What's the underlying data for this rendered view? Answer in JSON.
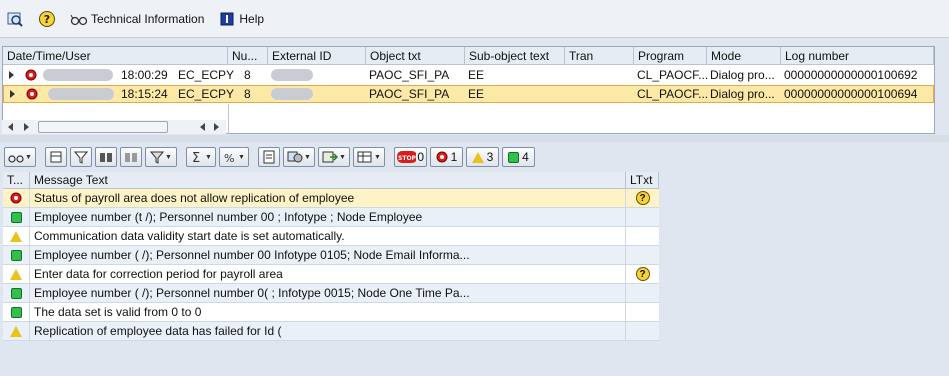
{
  "toolbar": {
    "tech_info_label": "Technical Information",
    "help_label": "Help"
  },
  "log_table": {
    "columns": [
      "Date/Time/User",
      "Nu...",
      "External ID",
      "Object txt",
      "Sub-object text",
      "Tran",
      "Program",
      "Mode",
      "Log number"
    ],
    "rows": [
      {
        "time": "18:00:29",
        "user": "EC_ECPY",
        "num": "8",
        "object": "PAOC_SFI_PA",
        "subobject": "EE",
        "program": "CL_PAOCF...",
        "mode": "Dialog pro...",
        "log": "00000000000000100692",
        "selected": false
      },
      {
        "time": "18:15:24",
        "user": "EC_ECPY",
        "num": "8",
        "object": "PAOC_SFI_PA",
        "subobject": "EE",
        "program": "CL_PAOCF...",
        "mode": "Dialog pro...",
        "log": "00000000000000100694",
        "selected": true
      }
    ]
  },
  "msg_toolbar": {
    "stop_count": "0",
    "error_count": "1",
    "warning_count": "3",
    "ok_count": "4"
  },
  "messages": {
    "header_type": "T...",
    "header_text": "Message Text",
    "header_ltxt": "LTxt",
    "rows": [
      {
        "type": "error",
        "text": "Status of payroll area      does not allow replication of employee",
        "ltxt": true
      },
      {
        "type": "ok",
        "text": "Employee number             (t                /); Personnel number 00              ; Infotype ; Node Employee",
        "ltxt": false
      },
      {
        "type": "warn",
        "text": "Communication data validity start date is set automatically.",
        "ltxt": false
      },
      {
        "type": "ok",
        "text": "Employee number             (                 /); Personnel number 00              Infotype 0105; Node Email Informa...",
        "ltxt": false
      },
      {
        "type": "warn",
        "text": "Enter data for correction period for payroll area",
        "ltxt": true
      },
      {
        "type": "ok",
        "text": "Employee number             (                 /); Personnel number 0(              ; Infotype 0015; Node One Time Pa...",
        "ltxt": false
      },
      {
        "type": "ok",
        "text": "The data set is valid from 0              to 0",
        "ltxt": false
      },
      {
        "type": "warn",
        "text": "Replication of employee data has failed for Id              (",
        "ltxt": false
      }
    ]
  }
}
